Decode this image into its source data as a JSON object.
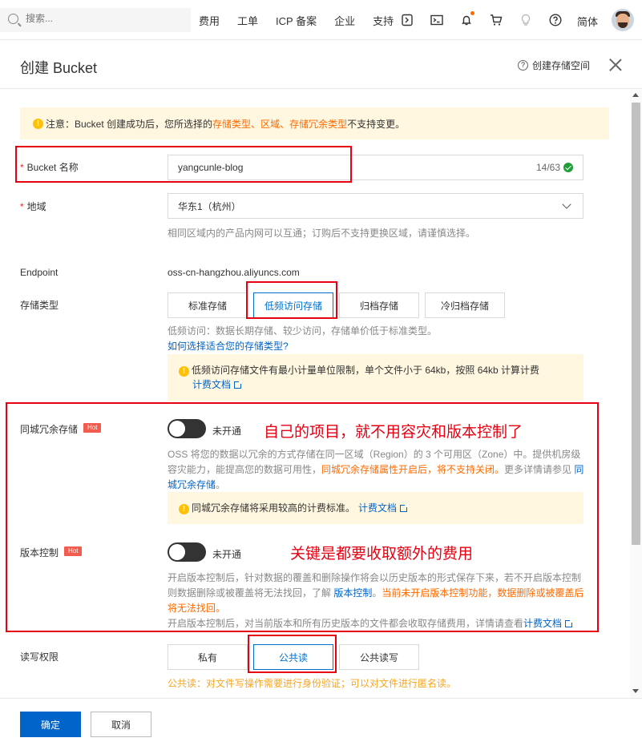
{
  "nav": {
    "search_placeholder": "搜索...",
    "links": [
      "费用",
      "工单",
      "ICP 备案",
      "企业",
      "支持"
    ],
    "lang": "简体"
  },
  "panel": {
    "title": "创建 Bucket",
    "help_link": "创建存储空间"
  },
  "notice": {
    "prefix": "注意：Bucket 创建成功后，您所选择的 ",
    "hl1": "存储类型",
    "sep1": "、",
    "hl2": "区域",
    "sep2": "、",
    "hl3": "存储冗余类型",
    "suffix": " 不支持变更。"
  },
  "bucket_name": {
    "label": "Bucket 名称",
    "value": "yangcunle-blog",
    "counter": "14/63"
  },
  "region": {
    "label": "地域",
    "value": "华东1（杭州）",
    "hint": "相同区域内的产品内网可以互通；订购后不支持更换区域，请谨慎选择。"
  },
  "endpoint": {
    "label": "Endpoint",
    "value": "oss-cn-hangzhou.aliyuncs.com"
  },
  "storage_class": {
    "label": "存储类型",
    "options": [
      "标准存储",
      "低频访问存储",
      "归档存储",
      "冷归档存储"
    ],
    "selected": "低频访问存储",
    "hint": "低频访问：数据长期存储、较少访问，存储单价低于标准类型。",
    "help_link": "如何选择适合您的存储类型?",
    "tip_line1": "低频访问存储文件有最小计量单位限制，单个文件小于 64kb，按照 64kb 计算计费",
    "tip_link": "计费文档"
  },
  "zone_redundancy": {
    "label": "同城冗余存储",
    "badge": "Hot",
    "state": "未开通",
    "hint_p1": "OSS 将您的数据以冗余的方式存储在同一区域（Region）的 3 个可用区（Zone）中。提供机房级容灾能力，能提高您的数据可用性，",
    "hint_warn": "同城冗余存储属性开启后，将不支持关闭。",
    "hint_p2": "更多详情请参见 ",
    "hint_link": "同城冗余存储",
    "hint_end": "。",
    "tip": "同城冗余存储将采用较高的计费标准。",
    "tip_link": "计费文档"
  },
  "versioning": {
    "label": "版本控制",
    "badge": "Hot",
    "state": "未开通",
    "hint_p1": "开启版本控制后，针对数据的覆盖和删除操作将会以历史版本的形式保存下来，若不开启版本控制则数据删除或被覆盖将无法找回，了解 ",
    "hint_link": "版本控制",
    "hint_p2": "。",
    "hint_warn": "当前未开启版本控制功能，数据删除或被覆盖后将无法找回。",
    "hint_line2": "开启版本控制后，对当前版本和所有历史版本的文件都会收取存储费用，详情请查看",
    "hint_link2": "计费文档"
  },
  "acl": {
    "label": "读写权限",
    "options": [
      "私有",
      "公共读",
      "公共读写"
    ],
    "selected": "公共读",
    "hint": "公共读：对文件写操作需要进行身份验证；可以对文件进行匿名读。"
  },
  "annotations": {
    "a1": "自己的项目，就不用容灾和版本控制了",
    "a2": "关键是都要收取额外的费用"
  },
  "footer": {
    "confirm": "确定",
    "cancel": "取消"
  }
}
